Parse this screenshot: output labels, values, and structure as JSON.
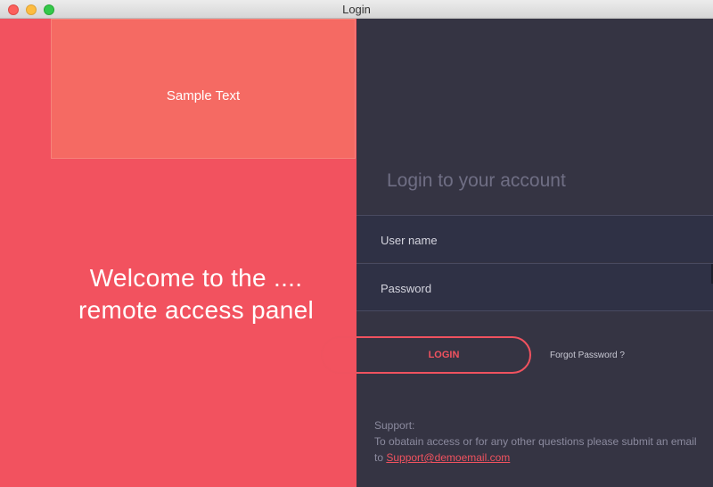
{
  "window": {
    "title": "Login"
  },
  "left_panel": {
    "sample_text": "Sample Text",
    "welcome_line1": "Welcome to the ....",
    "welcome_line2": "remote access panel"
  },
  "login_form": {
    "heading": "Login to your account",
    "username_placeholder": "User name",
    "password_placeholder": "Password",
    "login_label": "LOGIN",
    "forgot_label": "Forgot Password ?"
  },
  "support": {
    "label": "Support:",
    "text": "To obatain access or for any other questions please submit an email to",
    "email": "Support@demoemail.com"
  },
  "colors": {
    "accent": "#f2525f",
    "sample_box": "#f56a63",
    "dark_panel": "#353443",
    "field_bg": "#2f3145"
  }
}
